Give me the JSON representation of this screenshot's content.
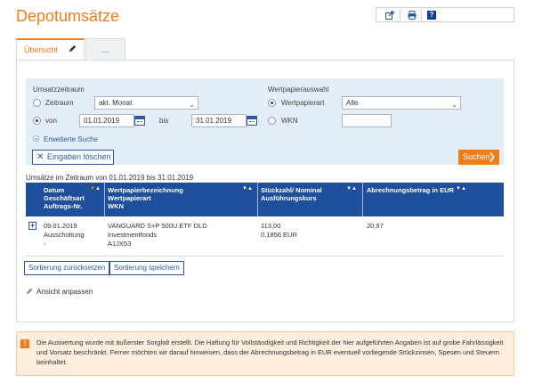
{
  "page": {
    "title": "Depotumsätze"
  },
  "toolbar": {
    "export_icon": "export-icon",
    "print_icon": "printer-icon",
    "help_label": "?"
  },
  "tabs": {
    "active_label": "Übersicht",
    "more_label": "..."
  },
  "search": {
    "period_title": "Umsatzzeitraum",
    "zeitraum_label": "Zeitraum",
    "zeitraum_value": "akt. Monat",
    "von_label": "von",
    "von_value": "01.01.2019",
    "bis_label": "bis",
    "bis_value": "31.01.2019",
    "security_title": "Wertpapierauswahl",
    "wpart_label": "Wertpapierart",
    "wpart_value": "Alle",
    "wkn_label": "WKN",
    "wkn_value": "",
    "extended_label": "Erweiterte Suche",
    "clear_label": "Eingaben löschen",
    "search_label": "Suchen"
  },
  "results": {
    "period_text": "Umsätze im Zeitraum von 01.01.2019 bis 31.01.2019",
    "columns": [
      {
        "l1": "Datum",
        "l2": "Geschäftsart",
        "l3": "Auftrags-Nr."
      },
      {
        "l1": "Wertpapierbezeichnung",
        "l2": "Wertpapierart",
        "l3": "WKN"
      },
      {
        "l1": "Stückzahl/ Nominal",
        "l2": "Ausführungskurs",
        "l3": ""
      },
      {
        "l1": "Abrechnungsbetrag in EUR",
        "l2": "",
        "l3": ""
      }
    ],
    "rows": [
      {
        "date": "09.01.2019",
        "type": "Ausschüttung",
        "order": "-",
        "name": "VANGUARD S+P 500U.ETF DLD",
        "kind": "Investmentfonds",
        "wkn": "A1JX53",
        "qty": "113,00",
        "price": "0,1856 EUR",
        "amount": "20,97"
      }
    ]
  },
  "actions": {
    "reset_sort": "Sortierung zurücksetzen",
    "save_sort": "Sortierung speichern",
    "adjust_view": "Ansicht anpassen"
  },
  "notice": {
    "text": "Die Auswertung wurde mit äußerster Sorgfalt erstellt. Die Haftung für Vollständigkeit und Richtigkeit der hier aufgeführten Angaben ist auf grobe Fahrlässigkeit und Vorsatz beschränkt. Ferner möchten wir darauf hinweisen, dass der Abrechnungsbetrag in EUR eventuell vorliegende Stückzinsen, Spesen und Steuern beinhaltet."
  },
  "colors": {
    "accent": "#f07d19",
    "header_blue": "#1e4f9c",
    "search_bg": "#e3eef9",
    "link_blue": "#2c5aa0"
  }
}
